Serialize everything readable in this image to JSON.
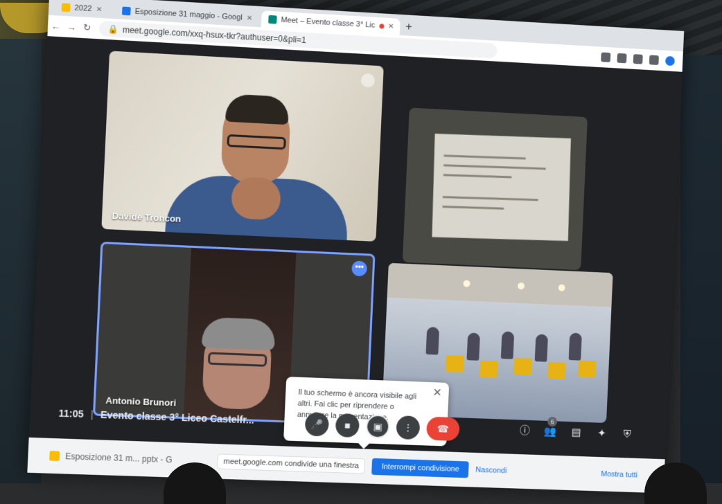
{
  "browser": {
    "tabs": [
      {
        "label": "2022",
        "icon": "doc-icon",
        "color": "#fbbc04",
        "active": false
      },
      {
        "label": "Esposizione 31 maggio - Googl",
        "icon": "drive-icon",
        "color": "#1a73e8",
        "active": false
      },
      {
        "label": "Meet – Evento classe 3° Lic",
        "icon": "meet-icon",
        "color": "#00897b",
        "active": true
      }
    ],
    "url": "meet.google.com/xxq-hsux-tkr?authuser=0&pli=1"
  },
  "participants": [
    {
      "name": "Davide Troncon"
    },
    {
      "name": ""
    },
    {
      "name": "Antonio Brunori"
    },
    {
      "name": ""
    }
  ],
  "notice": {
    "text": "Il tuo schermo è ancora visibile agli altri. Fai clic per riprendere o annullare la presentazione."
  },
  "meeting": {
    "time": "11:05",
    "separator": "|",
    "title": "Evento classe 3° Liceo Castelfr..."
  },
  "controls": {
    "participants_count": "6"
  },
  "share_bar": {
    "tab_label": "Esposizione 31 m... pptx - G",
    "message": "meet.google.com condivide una finestra",
    "stop_label": "Interrompi condivisione",
    "hide_label": "Nascondi",
    "show_all_label": "Mostra tutti"
  },
  "colors": {
    "active_speaker_border": "#7ba0ff",
    "hangup": "#ea4335",
    "stop_button": "#1a73e8"
  }
}
